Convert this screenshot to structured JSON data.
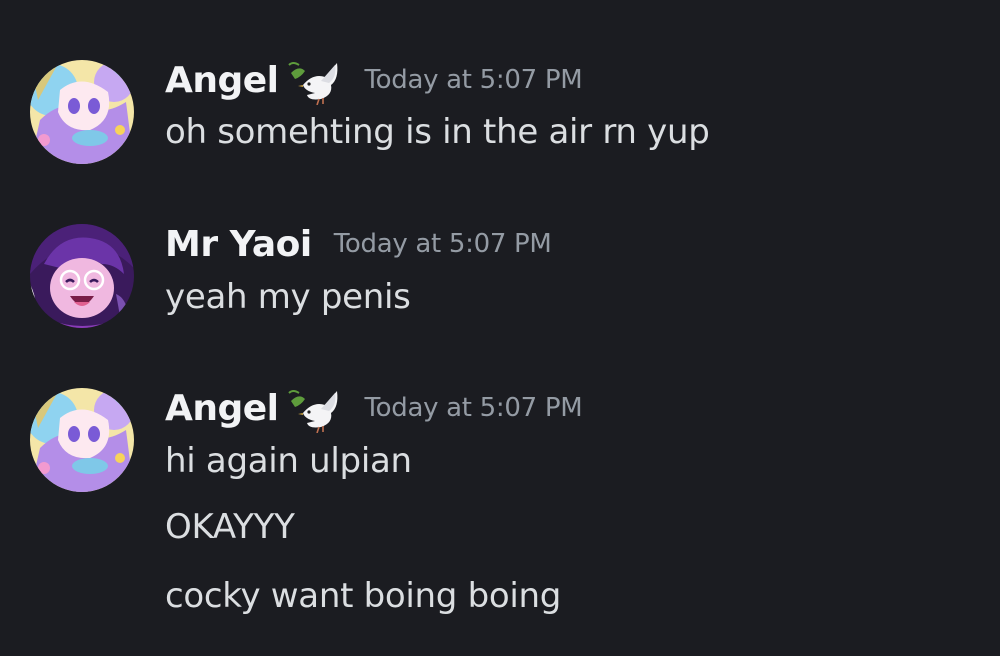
{
  "messages": [
    {
      "author": "Angel",
      "badge_icon": "dove-emoji-icon",
      "timestamp": "Today at 5:07 PM",
      "lines": [
        "oh somehting is in the air rn yup"
      ]
    },
    {
      "author": "Mr Yaoi",
      "timestamp": "Today at 5:07 PM",
      "lines": [
        "yeah my penis"
      ]
    },
    {
      "author": "Angel",
      "badge_icon": "dove-emoji-icon",
      "timestamp": "Today at 5:07 PM",
      "lines": [
        "hi again ulpian",
        "OKAYYY",
        "cocky want boing boing"
      ]
    }
  ],
  "colors": {
    "background": "#1b1c21",
    "username": "#f2f3f5",
    "timestamp": "#949ba4",
    "message_text": "#dbdee1"
  }
}
